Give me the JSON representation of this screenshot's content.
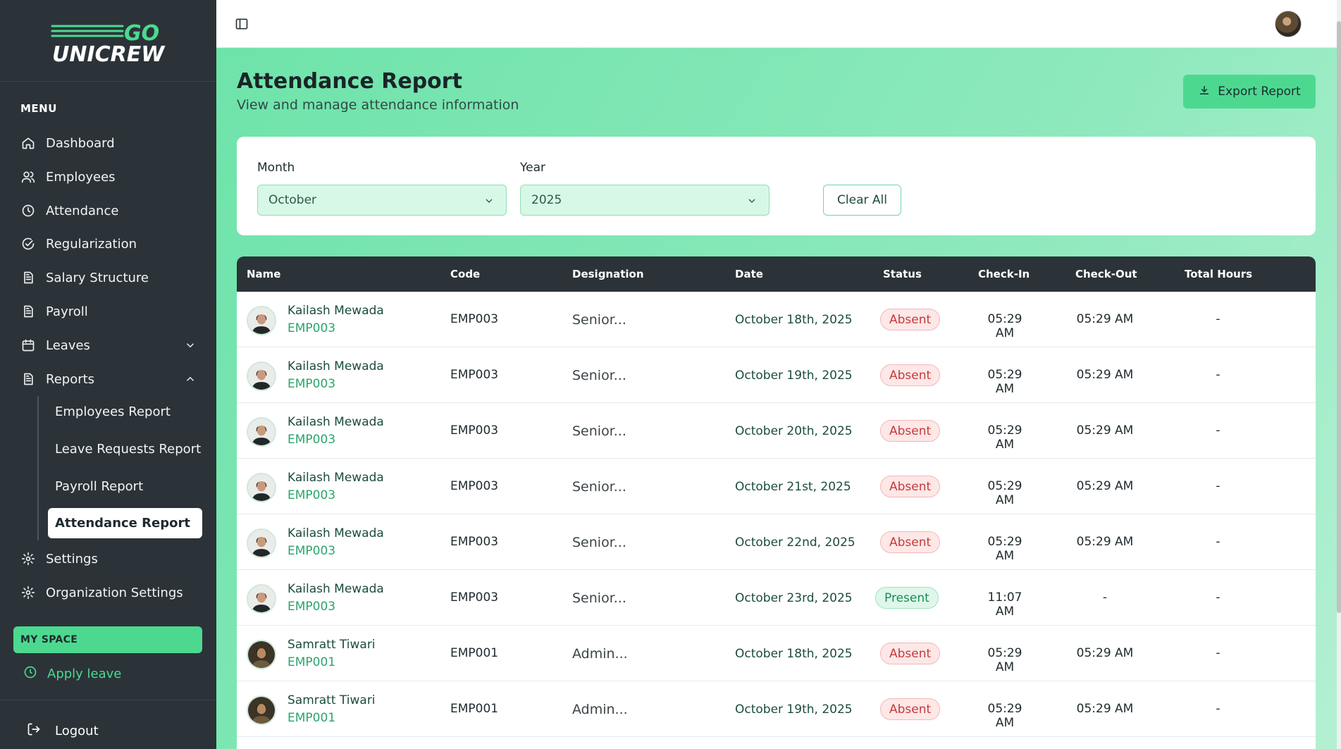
{
  "brand": {
    "logo_top": "GO",
    "logo_bottom": "UNICREW"
  },
  "sidebar": {
    "menu_label": "MENU",
    "items": [
      {
        "label": "Dashboard",
        "icon": "home-icon"
      },
      {
        "label": "Employees",
        "icon": "users-icon"
      },
      {
        "label": "Attendance",
        "icon": "clock-icon"
      },
      {
        "label": "Regularization",
        "icon": "check-circle-icon"
      },
      {
        "label": "Salary Structure",
        "icon": "document-icon"
      },
      {
        "label": "Payroll",
        "icon": "document-icon"
      },
      {
        "label": "Leaves",
        "icon": "calendar-icon"
      },
      {
        "label": "Reports",
        "icon": "document-icon"
      }
    ],
    "report_subitems": [
      {
        "label": "Employees Report"
      },
      {
        "label": "Leave Requests Report"
      },
      {
        "label": "Payroll Report"
      },
      {
        "label": "Attendance Report"
      }
    ],
    "settings": "Settings",
    "org_settings": "Organization Settings",
    "my_space": "MY SPACE",
    "apply_leave": "Apply leave",
    "logout": "Logout"
  },
  "page": {
    "title": "Attendance Report",
    "subtitle": "View and manage attendance information",
    "export_label": "Export Report"
  },
  "filters": {
    "month_label": "Month",
    "month_value": "October",
    "year_label": "Year",
    "year_value": "2025",
    "clear_label": "Clear All"
  },
  "table": {
    "columns": [
      "Name",
      "Code",
      "Designation",
      "Date",
      "Status",
      "Check-In",
      "Check-Out",
      "Total Hours"
    ],
    "rows": [
      {
        "name": "Kailash Mewada",
        "code_sub": "EMP003",
        "code": "EMP003",
        "designation": "Senior...",
        "date": "October 18th, 2025",
        "status": "Absent",
        "check_in": "05:29 AM",
        "check_out": "05:29 AM",
        "total": "-"
      },
      {
        "name": "Kailash Mewada",
        "code_sub": "EMP003",
        "code": "EMP003",
        "designation": "Senior...",
        "date": "October 19th, 2025",
        "status": "Absent",
        "check_in": "05:29 AM",
        "check_out": "05:29 AM",
        "total": "-"
      },
      {
        "name": "Kailash Mewada",
        "code_sub": "EMP003",
        "code": "EMP003",
        "designation": "Senior...",
        "date": "October 20th, 2025",
        "status": "Absent",
        "check_in": "05:29 AM",
        "check_out": "05:29 AM",
        "total": "-"
      },
      {
        "name": "Kailash Mewada",
        "code_sub": "EMP003",
        "code": "EMP003",
        "designation": "Senior...",
        "date": "October 21st, 2025",
        "status": "Absent",
        "check_in": "05:29 AM",
        "check_out": "05:29 AM",
        "total": "-"
      },
      {
        "name": "Kailash Mewada",
        "code_sub": "EMP003",
        "code": "EMP003",
        "designation": "Senior...",
        "date": "October 22nd, 2025",
        "status": "Absent",
        "check_in": "05:29 AM",
        "check_out": "05:29 AM",
        "total": "-"
      },
      {
        "name": "Kailash Mewada",
        "code_sub": "EMP003",
        "code": "EMP003",
        "designation": "Senior...",
        "date": "October 23rd, 2025",
        "status": "Present",
        "check_in": "11:07 AM",
        "check_out": "-",
        "total": "-"
      },
      {
        "name": "Samratt Tiwari",
        "code_sub": "EMP001",
        "code": "EMP001",
        "designation": "Admin...",
        "date": "October 18th, 2025",
        "status": "Absent",
        "check_in": "05:29 AM",
        "check_out": "05:29 AM",
        "total": "-"
      },
      {
        "name": "Samratt Tiwari",
        "code_sub": "EMP001",
        "code": "EMP001",
        "designation": "Admin...",
        "date": "October 19th, 2025",
        "status": "Absent",
        "check_in": "05:29 AM",
        "check_out": "05:29 AM",
        "total": "-"
      }
    ]
  },
  "colors": {
    "sidebar_bg": "#2b3338",
    "accent": "#4cd98f",
    "absent": "#c43b3b",
    "present": "#1f8a56"
  }
}
